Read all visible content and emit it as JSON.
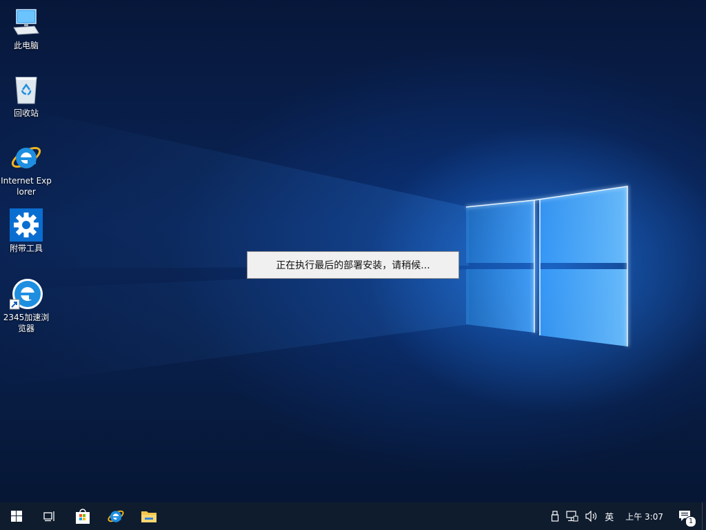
{
  "desktop": {
    "icons": [
      {
        "label": "此电脑",
        "icon": "this-pc-icon"
      },
      {
        "label": "回收站",
        "icon": "recycle-bin-icon"
      },
      {
        "label": "Internet Explorer",
        "icon": "internet-explorer-icon"
      },
      {
        "label": "附带工具",
        "icon": "gear-icon"
      },
      {
        "label": "2345加速浏览器",
        "icon": "browser-2345-icon"
      }
    ]
  },
  "dialog": {
    "message": "正在执行最后的部署安装，请稍候..."
  },
  "taskbar": {
    "start": "windows-start-icon",
    "task_view": "task-view-icon",
    "store": "store-icon",
    "ie": "internet-explorer-icon",
    "explorer": "file-explorer-icon"
  },
  "tray": {
    "usb": "usb-icon",
    "network": "network-icon",
    "volume": "volume-icon",
    "ime_label": "英",
    "clock": "上午 3:07",
    "notification_count": "1"
  },
  "colors": {
    "taskbar": "#0f1c2e",
    "wallpaper_glow": "#2a8cff",
    "ie_blue": "#1e8fe0",
    "gear_tile": "#0a6ed1"
  }
}
